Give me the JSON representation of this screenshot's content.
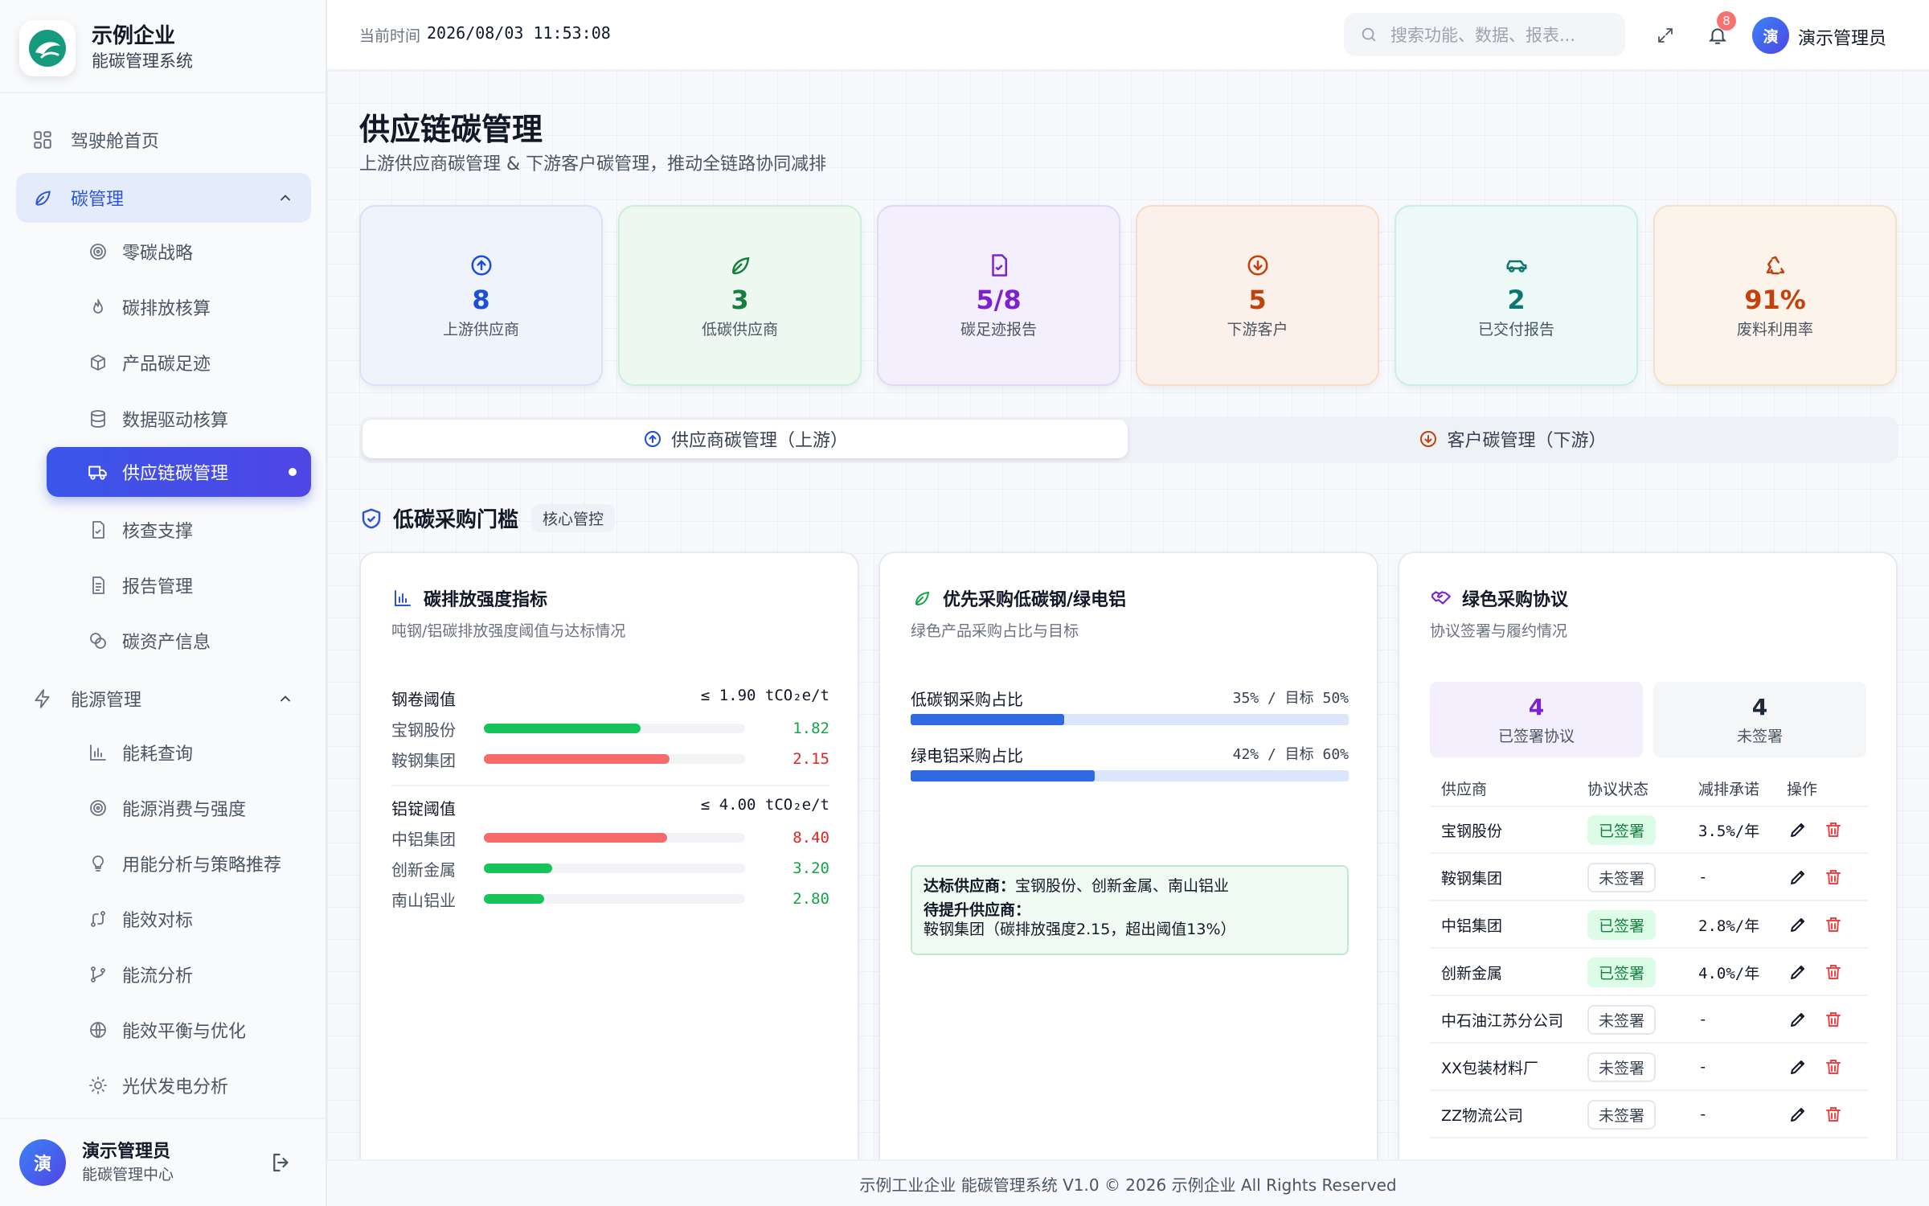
{
  "brand": {
    "name": "示例企业",
    "subtitle": "能碳管理系统"
  },
  "topbar": {
    "time_label": "当前时间",
    "time_value": "2026/08/03 11:53:08",
    "search_placeholder": "搜索功能、数据、报表...",
    "notification_count": "8",
    "avatar_char": "演",
    "username": "演示管理员"
  },
  "nav": {
    "home": "驾驶舱首页",
    "carbon_group": "碳管理",
    "carbon_items": [
      "零碳战略",
      "碳排放核算",
      "产品碳足迹",
      "数据驱动核算",
      "供应链碳管理",
      "核查支撑",
      "报告管理",
      "碳资产信息"
    ],
    "energy_group": "能源管理",
    "energy_items": [
      "能耗查询",
      "能源消费与强度",
      "用能分析与策略推荐",
      "能效对标",
      "能流分析",
      "能效平衡与优化",
      "光伏发电分析"
    ]
  },
  "user_footer": {
    "avatar_char": "演",
    "name": "演示管理员",
    "role": "能碳管理中心"
  },
  "page": {
    "title": "供应链碳管理",
    "subtitle": "上游供应商碳管理 & 下游客户碳管理，推动全链路协同减排"
  },
  "stats": [
    {
      "value": "8",
      "label": "上游供应商",
      "icon": "arrow-up-circle-icon",
      "color": "#1d4ed8"
    },
    {
      "value": "3",
      "label": "低碳供应商",
      "icon": "leaf-icon",
      "color": "#15803d"
    },
    {
      "value": "5/8",
      "label": "碳足迹报告",
      "icon": "file-check-icon",
      "color": "#7e22ce"
    },
    {
      "value": "5",
      "label": "下游客户",
      "icon": "arrow-down-circle-icon",
      "color": "#c2410c"
    },
    {
      "value": "2",
      "label": "已交付报告",
      "icon": "car-icon",
      "color": "#0f766e"
    },
    {
      "value": "91%",
      "label": "废料利用率",
      "icon": "recycle-icon",
      "color": "#c2410c"
    }
  ],
  "tabs": {
    "upstream": "供应商碳管理（上游）",
    "downstream": "客户碳管理（下游）"
  },
  "section": {
    "title": "低碳采购门槛",
    "tag": "核心管控"
  },
  "card_intensity": {
    "title": "碳排放强度指标",
    "subtitle": "吨钢/铝碳排放强度阈值与达标情况",
    "groups": [
      {
        "name": "钢卷阈值",
        "threshold": "≤ 1.90 tCO₂e/t",
        "rows": [
          {
            "name": "宝钢股份",
            "value": "1.82",
            "fill": 0.6,
            "ok": true
          },
          {
            "name": "鞍钢集团",
            "value": "2.15",
            "fill": 0.71,
            "ok": false
          }
        ]
      },
      {
        "name": "铝锭阈值",
        "threshold": "≤ 4.00 tCO₂e/t",
        "rows": [
          {
            "name": "中铝集团",
            "value": "8.40",
            "fill": 0.7,
            "ok": false
          },
          {
            "name": "创新金属",
            "value": "3.20",
            "fill": 0.26,
            "ok": true
          },
          {
            "name": "南山铝业",
            "value": "2.80",
            "fill": 0.23,
            "ok": true
          }
        ]
      }
    ]
  },
  "card_green": {
    "title": "优先采购低碳钢/绿电铝",
    "subtitle": "绿色产品采购占比与目标",
    "items": [
      {
        "label": "低碳钢采购占比",
        "value_text": "35% / 目标 50%",
        "fill": 0.35
      },
      {
        "label": "绿电铝采购占比",
        "value_text": "42% / 目标 60%",
        "fill": 0.42
      }
    ],
    "note_label_1": "达标供应商：",
    "note_text_1": "宝钢股份、创新金属、南山铝业",
    "note_label_2": "待提升供应商：",
    "note_text_2": "鞍钢集团（碳排放强度2.15，超出阈值13%）"
  },
  "card_agreement": {
    "title": "绿色采购协议",
    "subtitle": "协议签署与履约情况",
    "signed_count": "4",
    "signed_label": "已签署协议",
    "unsigned_count": "4",
    "unsigned_label": "未签署",
    "headers": [
      "供应商",
      "协议状态",
      "减排承诺",
      "操作"
    ],
    "rows": [
      {
        "supplier": "宝钢股份",
        "status": "已签署",
        "signed": true,
        "commit": "3.5%/年"
      },
      {
        "supplier": "鞍钢集团",
        "status": "未签署",
        "signed": false,
        "commit": "-"
      },
      {
        "supplier": "中铝集团",
        "status": "已签署",
        "signed": true,
        "commit": "2.8%/年"
      },
      {
        "supplier": "创新金属",
        "status": "已签署",
        "signed": true,
        "commit": "4.0%/年"
      },
      {
        "supplier": "中石油江苏分公司",
        "status": "未签署",
        "signed": false,
        "commit": "-"
      },
      {
        "supplier": "XX包装材料厂",
        "status": "未签署",
        "signed": false,
        "commit": "-"
      },
      {
        "supplier": "ZZ物流公司",
        "status": "未签署",
        "signed": false,
        "commit": "-"
      }
    ]
  },
  "footer": "示例工业企业 能碳管理系统 V1.0 © 2026 示例企业 All Rights Reserved",
  "colors": {
    "accent": "#3a56e8",
    "success": "#16c45a",
    "danger": "#f56b6b",
    "progress": "#2f6ae0"
  }
}
